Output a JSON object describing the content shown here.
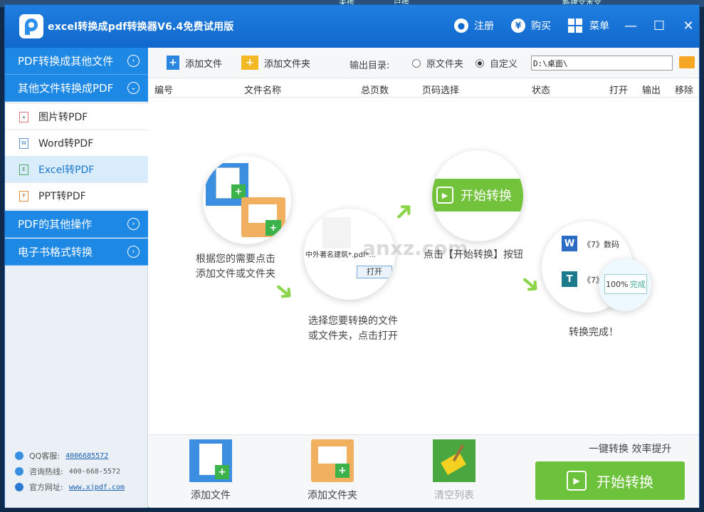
{
  "window": {
    "title": "excel转换成pdf转换器V6.4免费试用版",
    "register_label": "注册",
    "buy_label": "购买",
    "menu_label": "菜单",
    "minimize": "—",
    "maximize": "☐",
    "close": "✕"
  },
  "desktop_strip": [
    "未传",
    "已传",
    "新建文本文"
  ],
  "sidebar": {
    "sections": [
      {
        "label": "PDF转换成其他文件",
        "chevron": "›"
      },
      {
        "label": "其他文件转换成PDF",
        "chevron": "⌄"
      },
      {
        "label": "PDF的其他操作",
        "chevron": "›"
      },
      {
        "label": "电子书格式转换",
        "chevron": "›"
      }
    ],
    "items": [
      {
        "label": "图片转PDF",
        "icon": "image-file-icon"
      },
      {
        "label": "Word转PDF",
        "icon": "word-file-icon"
      },
      {
        "label": "Excel转PDF",
        "icon": "excel-file-icon"
      },
      {
        "label": "PPT转PDF",
        "icon": "ppt-file-icon"
      }
    ],
    "contact": {
      "qq_label": "QQ客服:",
      "qq_value": "4006685572",
      "hotline_label": "咨询热线:",
      "hotline_value": "400-668-5572",
      "site_label": "官方网址:",
      "site_value": "www.xjpdf.com"
    }
  },
  "toolbar": {
    "add_file": "添加文件",
    "add_folder": "添加文件夹",
    "output_dir_label": "输出目录:",
    "radio_original": "原文件夹",
    "radio_custom": "自定义",
    "path_value": "D:\\桌面\\"
  },
  "table": {
    "columns": [
      "编号",
      "文件名称",
      "总页数",
      "页码选择",
      "状态",
      "打开",
      "输出",
      "移除"
    ]
  },
  "illustration": {
    "step1": [
      "根据您的需要点击",
      "添加文件或文件夹"
    ],
    "step2": [
      "选择您要转换的文件",
      "或文件夹，点击打开"
    ],
    "step3": "点击【开始转换】按钮",
    "step4": "转换完成！",
    "start_label": "开始转换",
    "dialog_filename": "中外著名建筑*.pdf*...",
    "dialog_open": "打开",
    "done_item1": "《7》数码",
    "done_item2": "《7》",
    "done_percent": "100%",
    "done_status": "完成",
    "watermark": "anxz.com"
  },
  "footer": {
    "add_file": "添加文件",
    "add_folder": "添加文件夹",
    "clear_list": "清空列表",
    "slogan": "一键转换 效率提升",
    "start_button": "开始转换"
  },
  "colors": {
    "title_blue": "#1168cc",
    "side_blue": "#1e88e5",
    "start_green": "#6cc23a",
    "active_item_bg": "#d9ecfb"
  }
}
